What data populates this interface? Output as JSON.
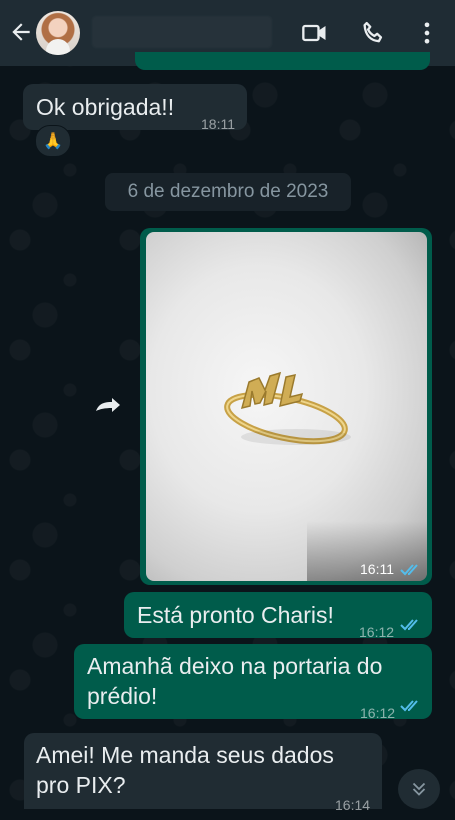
{
  "header": {
    "back_icon": "arrow-left-icon",
    "video_icon": "video-camera-icon",
    "call_icon": "phone-icon",
    "menu_icon": "more-vertical-icon"
  },
  "messages": [
    {
      "type": "incoming",
      "text": "Ok obrigada!!",
      "time": "18:11",
      "reaction": "🙏"
    },
    {
      "type": "date",
      "text": "6 de dezembro de 2023"
    },
    {
      "type": "outgoing_image",
      "time": "16:11",
      "status": "read"
    },
    {
      "type": "outgoing",
      "text": "Está pronto Charis!",
      "time": "16:12",
      "status": "read"
    },
    {
      "type": "outgoing",
      "text_lines": [
        "Amanhã deixo na portaria do",
        "prédio!"
      ],
      "time": "16:12",
      "status": "read"
    },
    {
      "type": "incoming",
      "text_lines": [
        "Amei! Me manda seus dados",
        "pro PIX?"
      ],
      "time": "16:14"
    }
  ],
  "colors": {
    "header_bg": "#1f2c34",
    "chat_bg": "#0b141a",
    "incoming_bubble": "#202c33",
    "outgoing_bubble": "#005c4b",
    "read_ticks": "#53bdeb"
  }
}
